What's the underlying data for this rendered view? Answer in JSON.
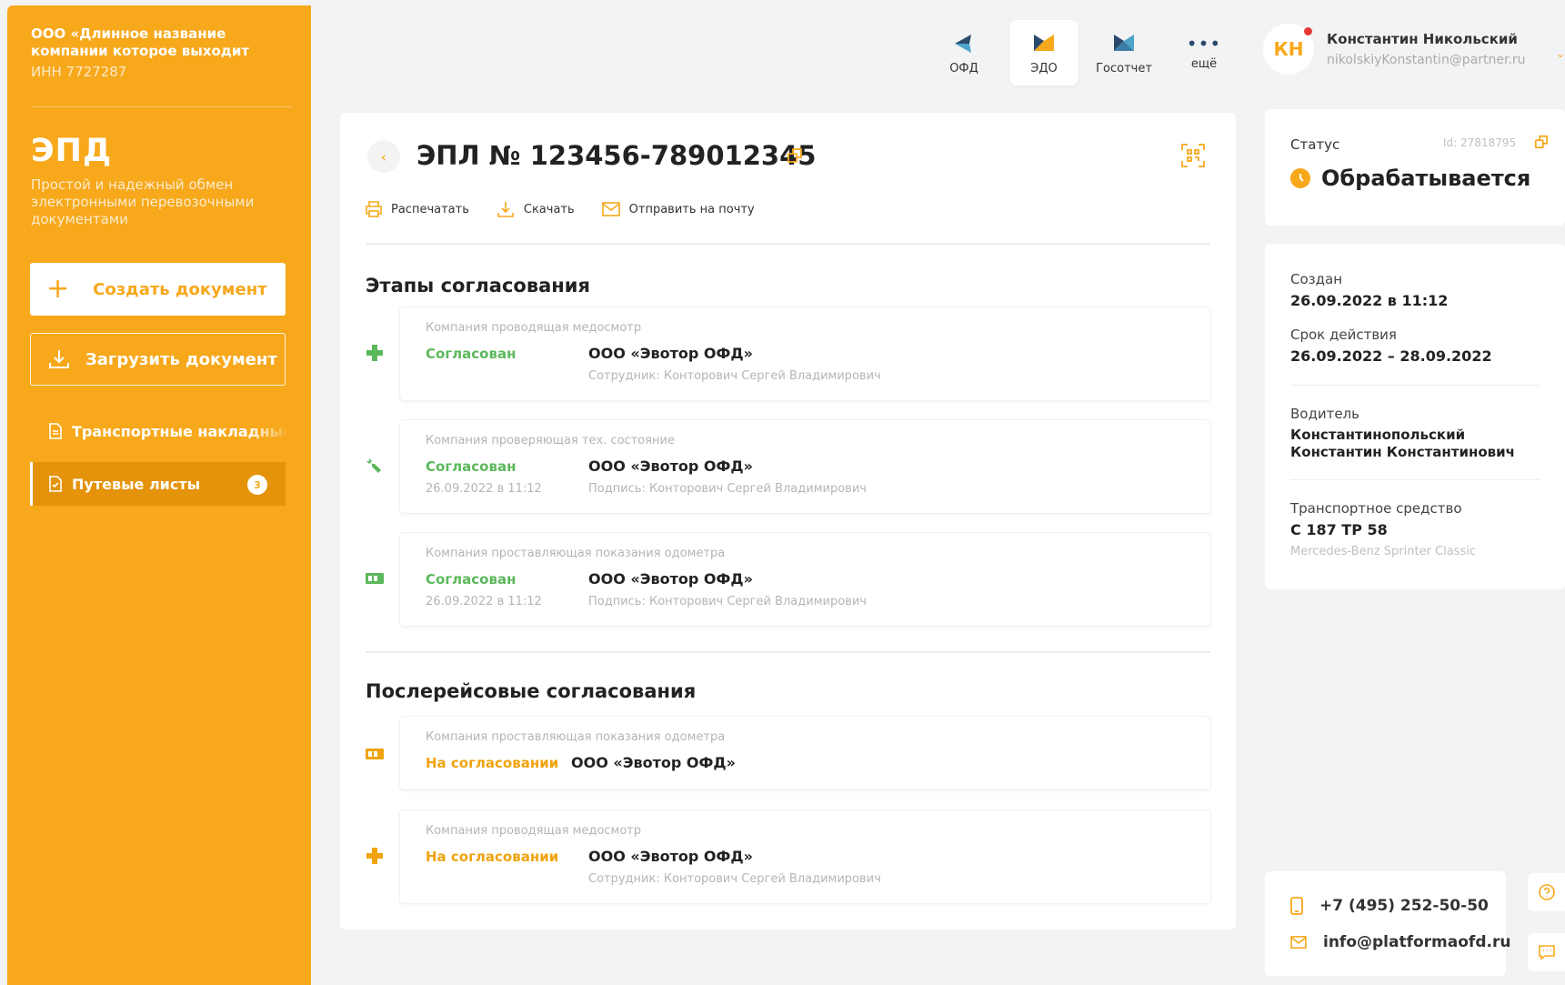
{
  "sidebar": {
    "company_name": "ООО «Длинное название компании которое выходит",
    "inn": "ИНН 7727287",
    "app_title": "ЭПД",
    "app_subtitle": "Простой и надежный обмен электронными перевозочными документами",
    "create_label": "Создать документ",
    "upload_label": "Загрузить документ",
    "nav": [
      {
        "label": "Транспортные накладные"
      },
      {
        "label": "Путевые листы",
        "badge": "3"
      }
    ]
  },
  "topnav": {
    "items": [
      {
        "label": "ОФД"
      },
      {
        "label": "ЭДО"
      },
      {
        "label": "Госотчет"
      },
      {
        "label": "ещё"
      }
    ]
  },
  "user": {
    "initials": "КН",
    "name": "Константин Никольский",
    "email": "nikolskiyKonstantin@partner.ru"
  },
  "document": {
    "title": "ЭПЛ № 123456-789012345",
    "actions": [
      {
        "label": "Распечатать",
        "icon": "printer-icon"
      },
      {
        "label": "Скачать",
        "icon": "download-icon"
      },
      {
        "label": "Отправить на почту",
        "icon": "mail-icon"
      }
    ]
  },
  "sections": {
    "stages_title": "Этапы согласования",
    "post_title": "Послерейсовые согласования"
  },
  "stages": [
    {
      "company": "Компания проводящая медосмотр",
      "status": "Согласован",
      "date": "",
      "org": "ООО «Эвотор ОФД»",
      "signer": "Сотрудник: Конторович Сергей Владимирович",
      "icon": "medical-cross-icon"
    },
    {
      "company": "Компания проверяющая тех. состояние",
      "status": "Согласован",
      "date": "26.09.2022 в 11:12",
      "org": "ООО «Эвотор ОФД»",
      "signer": "Подпись: Конторович Сергей Владимирович",
      "icon": "wrench-icon"
    },
    {
      "company": "Компания проставляющая показания одометра",
      "status": "Согласован",
      "date": "26.09.2022 в 11:12",
      "org": "ООО «Эвотор ОФД»",
      "signer": "Подпись: Конторович Сергей Владимирович",
      "icon": "odometer-icon"
    }
  ],
  "post_stages": [
    {
      "company": "Компания проставляющая показания одометра",
      "status": "На согласовании",
      "org": "ООО «Эвотор ОФД»",
      "icon": "odometer-icon"
    },
    {
      "company": "Компания проводящая медосмотр",
      "status": "На согласовании",
      "org": "ООО «Эвотор ОФД»",
      "signer": "Сотрудник: Конторович Сергей Владимирович",
      "icon": "medical-cross-icon"
    }
  ],
  "status_card": {
    "label": "Статус",
    "id": "Id: 27818795",
    "value": "Обрабатывается"
  },
  "info": {
    "created_label": "Создан",
    "created_value": "26.09.2022 в 11:12",
    "validity_label": "Срок действия",
    "validity_value": "26.09.2022 – 28.09.2022",
    "driver_label": "Водитель",
    "driver_value_1": "Константинопольский",
    "driver_value_2": "Константин Константинович",
    "vehicle_label": "Транспортное средство",
    "vehicle_value": "С 187 ТР 58",
    "vehicle_model": "Mercedes-Benz Sprinter Classic"
  },
  "contacts": {
    "phone": "+7 (495) 252-50-50",
    "email": "info@platformaofd.ru"
  },
  "colors": {
    "accent": "#f7a81b",
    "approved": "#5cb85c",
    "pending": "#f0a30e"
  }
}
